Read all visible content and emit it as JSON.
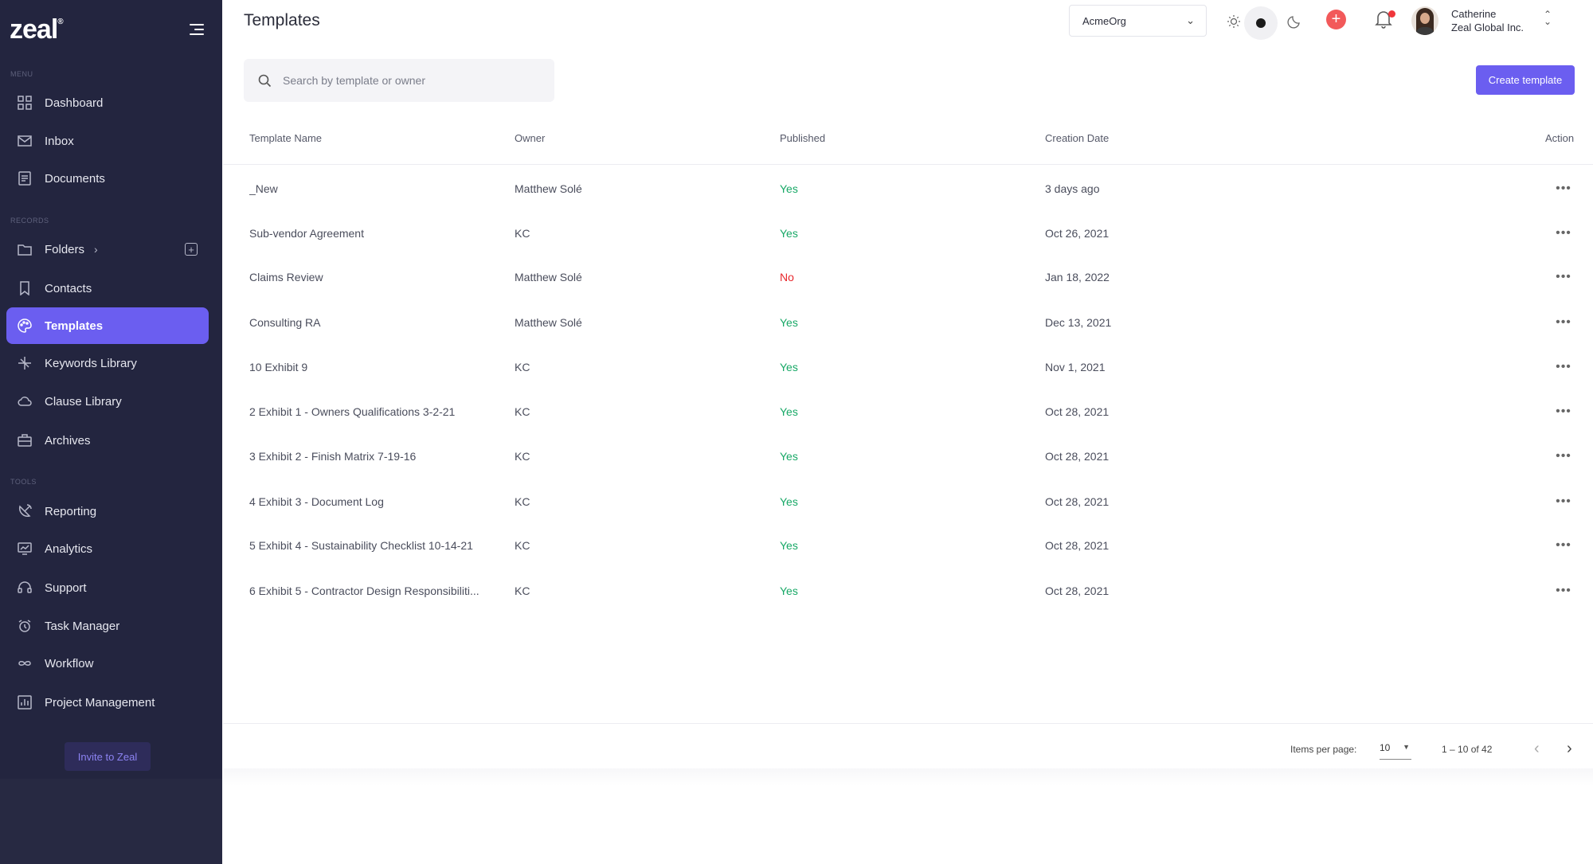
{
  "app": {
    "logo": "zeal",
    "logo_mark": "®"
  },
  "sidebar": {
    "section_menu": "MENU",
    "section_records": "RECORDS",
    "section_tools": "TOOLS",
    "items": [
      {
        "label": "Dashboard",
        "icon": "grid-icon"
      },
      {
        "label": "Inbox",
        "icon": "mail-icon"
      },
      {
        "label": "Documents",
        "icon": "document-icon"
      },
      {
        "label": "Folders",
        "icon": "folder-icon"
      },
      {
        "label": "Contacts",
        "icon": "bookmark-icon"
      },
      {
        "label": "Templates",
        "icon": "palette-icon"
      },
      {
        "label": "Keywords Library",
        "icon": "sparkle-icon"
      },
      {
        "label": "Clause Library",
        "icon": "cloud-icon"
      },
      {
        "label": "Archives",
        "icon": "briefcase-icon"
      },
      {
        "label": "Reporting",
        "icon": "satellite-icon"
      },
      {
        "label": "Analytics",
        "icon": "monitor-chart-icon"
      },
      {
        "label": "Support",
        "icon": "headset-icon"
      },
      {
        "label": "Task Manager",
        "icon": "alarm-icon"
      },
      {
        "label": "Workflow",
        "icon": "infinity-icon"
      },
      {
        "label": "Project Management",
        "icon": "chart-board-icon"
      }
    ],
    "folders_chevron": "›",
    "folders_add": "+",
    "invite_label": "Invite to Zeal",
    "active": "Templates"
  },
  "header": {
    "title": "Templates",
    "org": "AcmeOrg",
    "user_name": "Catherine",
    "user_org": "Zeal Global Inc.",
    "plus": "+"
  },
  "search": {
    "placeholder": "Search by template or owner"
  },
  "toolbar": {
    "create_label": "Create template"
  },
  "table": {
    "columns": [
      "Template Name",
      "Owner",
      "Published",
      "Creation Date",
      "Action"
    ],
    "rows": [
      {
        "name": "_New",
        "owner": "Matthew Solé",
        "published": "Yes",
        "date": "3 days ago"
      },
      {
        "name": "Sub-vendor Agreement",
        "owner": "KC",
        "published": "Yes",
        "date": "Oct 26, 2021"
      },
      {
        "name": "Claims Review",
        "owner": "Matthew Solé",
        "published": "No",
        "date": "Jan 18, 2022"
      },
      {
        "name": "Consulting RA",
        "owner": "Matthew Solé",
        "published": "Yes",
        "date": "Dec 13, 2021"
      },
      {
        "name": "10 Exhibit 9",
        "owner": "KC",
        "published": "Yes",
        "date": "Nov 1, 2021"
      },
      {
        "name": "2 Exhibit 1 - Owners Qualifications 3-2-21",
        "owner": "KC",
        "published": "Yes",
        "date": "Oct 28, 2021"
      },
      {
        "name": "3 Exhibit 2 - Finish Matrix 7-19-16",
        "owner": "KC",
        "published": "Yes",
        "date": "Oct 28, 2021"
      },
      {
        "name": "4 Exhibit 3 - Document Log",
        "owner": "KC",
        "published": "Yes",
        "date": "Oct 28, 2021"
      },
      {
        "name": "5 Exhibit 4 - Sustainability Checklist 10-14-21",
        "owner": "KC",
        "published": "Yes",
        "date": "Oct 28, 2021"
      },
      {
        "name": "6 Exhibit 5 - Contractor Design Responsibiliti...",
        "owner": "KC",
        "published": "Yes",
        "date": "Oct 28, 2021"
      }
    ],
    "action_glyph": "•••"
  },
  "pagination": {
    "items_per_page_label": "Items per page:",
    "items_per_page": "10",
    "range": "1 – 10 of 42",
    "prev": "‹",
    "next": "›"
  },
  "colors": {
    "accent": "#6b5ef0",
    "sidebar": "#23253f",
    "yes": "#17a866",
    "no": "#e8282d"
  }
}
